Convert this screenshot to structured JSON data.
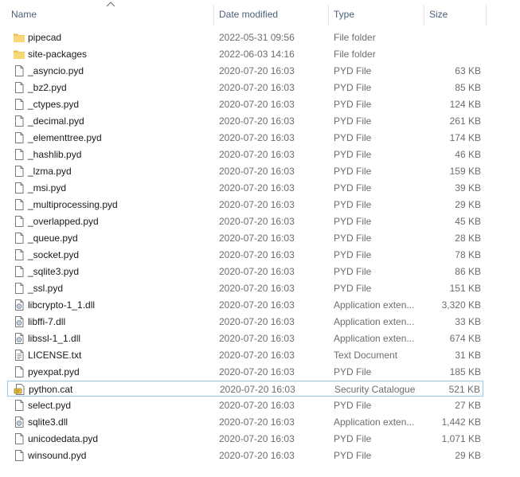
{
  "columns": {
    "name": "Name",
    "date_modified": "Date modified",
    "type": "Type",
    "size": "Size"
  },
  "sort": {
    "column": "name",
    "direction": "ascending"
  },
  "colors": {
    "header_text": "#4c607a",
    "folder": "#f8d775",
    "focus_border": "#99c9ef",
    "secondary_text": "#6d6d6d"
  },
  "files": [
    {
      "name": "pipecad",
      "date": "2022-05-31 09:56",
      "type": "File folder",
      "size": "",
      "icon": "folder-icon"
    },
    {
      "name": "site-packages",
      "date": "2022-06-03 14:16",
      "type": "File folder",
      "size": "",
      "icon": "folder-icon"
    },
    {
      "name": "_asyncio.pyd",
      "date": "2020-07-20 16:03",
      "type": "PYD File",
      "size": "63 KB",
      "icon": "file-icon"
    },
    {
      "name": "_bz2.pyd",
      "date": "2020-07-20 16:03",
      "type": "PYD File",
      "size": "85 KB",
      "icon": "file-icon"
    },
    {
      "name": "_ctypes.pyd",
      "date": "2020-07-20 16:03",
      "type": "PYD File",
      "size": "124 KB",
      "icon": "file-icon"
    },
    {
      "name": "_decimal.pyd",
      "date": "2020-07-20 16:03",
      "type": "PYD File",
      "size": "261 KB",
      "icon": "file-icon"
    },
    {
      "name": "_elementtree.pyd",
      "date": "2020-07-20 16:03",
      "type": "PYD File",
      "size": "174 KB",
      "icon": "file-icon"
    },
    {
      "name": "_hashlib.pyd",
      "date": "2020-07-20 16:03",
      "type": "PYD File",
      "size": "46 KB",
      "icon": "file-icon"
    },
    {
      "name": "_lzma.pyd",
      "date": "2020-07-20 16:03",
      "type": "PYD File",
      "size": "159 KB",
      "icon": "file-icon"
    },
    {
      "name": "_msi.pyd",
      "date": "2020-07-20 16:03",
      "type": "PYD File",
      "size": "39 KB",
      "icon": "file-icon"
    },
    {
      "name": "_multiprocessing.pyd",
      "date": "2020-07-20 16:03",
      "type": "PYD File",
      "size": "29 KB",
      "icon": "file-icon"
    },
    {
      "name": "_overlapped.pyd",
      "date": "2020-07-20 16:03",
      "type": "PYD File",
      "size": "45 KB",
      "icon": "file-icon"
    },
    {
      "name": "_queue.pyd",
      "date": "2020-07-20 16:03",
      "type": "PYD File",
      "size": "28 KB",
      "icon": "file-icon"
    },
    {
      "name": "_socket.pyd",
      "date": "2020-07-20 16:03",
      "type": "PYD File",
      "size": "78 KB",
      "icon": "file-icon"
    },
    {
      "name": "_sqlite3.pyd",
      "date": "2020-07-20 16:03",
      "type": "PYD File",
      "size": "86 KB",
      "icon": "file-icon"
    },
    {
      "name": "_ssl.pyd",
      "date": "2020-07-20 16:03",
      "type": "PYD File",
      "size": "151 KB",
      "icon": "file-icon"
    },
    {
      "name": "libcrypto-1_1.dll",
      "date": "2020-07-20 16:03",
      "type": "Application exten...",
      "size": "3,320 KB",
      "icon": "dll-icon"
    },
    {
      "name": "libffi-7.dll",
      "date": "2020-07-20 16:03",
      "type": "Application exten...",
      "size": "33 KB",
      "icon": "dll-icon"
    },
    {
      "name": "libssl-1_1.dll",
      "date": "2020-07-20 16:03",
      "type": "Application exten...",
      "size": "674 KB",
      "icon": "dll-icon"
    },
    {
      "name": "LICENSE.txt",
      "date": "2020-07-20 16:03",
      "type": "Text Document",
      "size": "31 KB",
      "icon": "text-file-icon"
    },
    {
      "name": "pyexpat.pyd",
      "date": "2020-07-20 16:03",
      "type": "PYD File",
      "size": "185 KB",
      "icon": "file-icon"
    },
    {
      "name": "python.cat",
      "date": "2020-07-20 16:03",
      "type": "Security Catalogue",
      "size": "521 KB",
      "icon": "security-catalog-icon",
      "focused": true
    },
    {
      "name": "select.pyd",
      "date": "2020-07-20 16:03",
      "type": "PYD File",
      "size": "27 KB",
      "icon": "file-icon"
    },
    {
      "name": "sqlite3.dll",
      "date": "2020-07-20 16:03",
      "type": "Application exten...",
      "size": "1,442 KB",
      "icon": "dll-icon"
    },
    {
      "name": "unicodedata.pyd",
      "date": "2020-07-20 16:03",
      "type": "PYD File",
      "size": "1,071 KB",
      "icon": "file-icon"
    },
    {
      "name": "winsound.pyd",
      "date": "2020-07-20 16:03",
      "type": "PYD File",
      "size": "29 KB",
      "icon": "file-icon"
    }
  ]
}
